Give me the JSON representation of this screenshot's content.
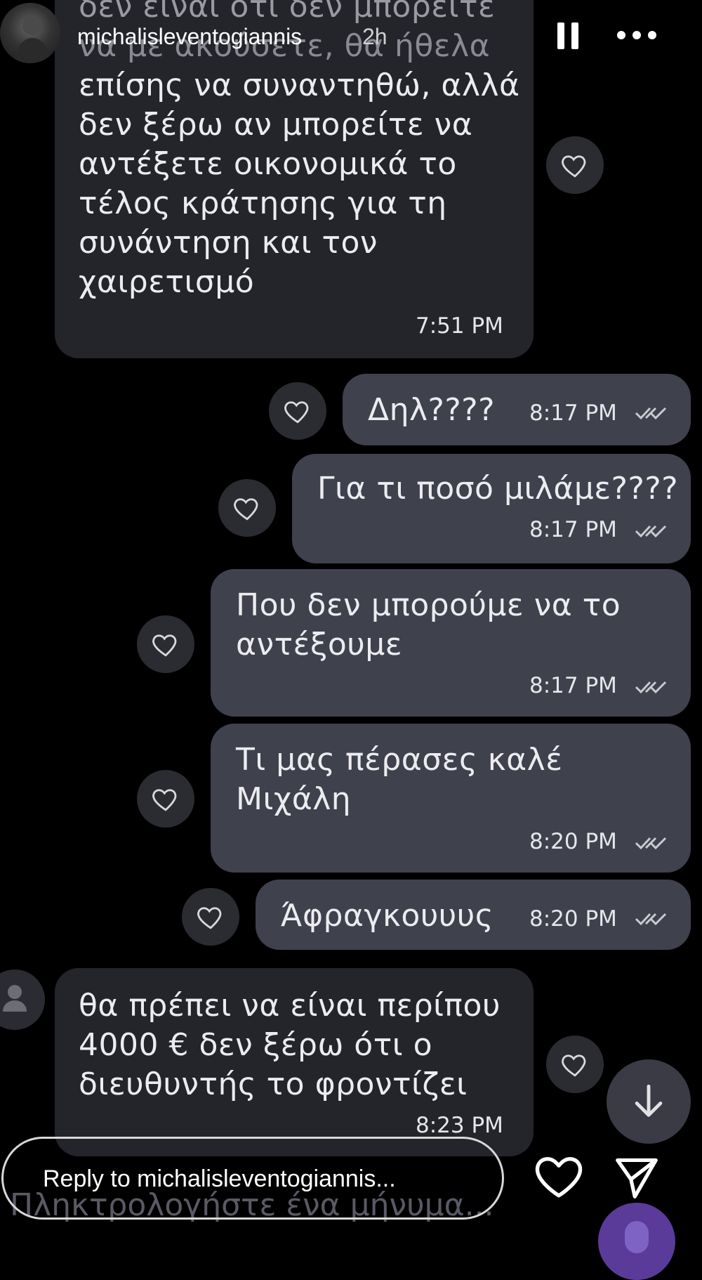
{
  "story": {
    "username": "michalisleventogiannis",
    "posted_ago": "2h",
    "reply_placeholder": "Reply to michalisleventogiannis..."
  },
  "chat": {
    "partial_top_text": "δεν είναι ότι δεν μπορείτε",
    "partial_second_line": "να με ακούσετε, θα ήθελα",
    "messages": [
      {
        "text": "επίσης να συναντηθώ, αλλά\nδεν ξέρω αν μπορείτε να\nαντέξετε οικονομικά το\nτέλος κράτησης για τη\nσυνάντηση και τον\nχαιρετισμό",
        "time": "7:51 PM"
      },
      {
        "text": "Δηλ????",
        "time": "8:17 PM"
      },
      {
        "text": "Για τι ποσό μιλάμε????",
        "time": "8:17 PM"
      },
      {
        "text": "Που δεν μπορούμε να το\nαντέξουμε",
        "time": "8:17 PM"
      },
      {
        "text": "Τι μας πέρασες καλέ\nΜιχάλη",
        "time": "8:20 PM"
      },
      {
        "text": "Άφραγκουυυς",
        "time": "8:20 PM"
      },
      {
        "text": "θα πρέπει να είναι περίπου\n4000 € δεν ξέρω ότι ο\nδιευθυντής το φροντίζει",
        "time": "8:23 PM"
      }
    ],
    "composer_placeholder": "Πληκτρολογήστε ένα μήνυμα..."
  },
  "icons": {
    "pause": "pause-icon",
    "more": "more-icon",
    "heart": "heart-icon",
    "send": "send-icon",
    "scroll_down": "arrow-down-icon",
    "read_ticks": "double-check-icon",
    "contact_avatar": "person-icon"
  },
  "colors": {
    "incoming_bubble": "#24252b",
    "outgoing_bubble": "#3f414d",
    "background": "#000000"
  }
}
